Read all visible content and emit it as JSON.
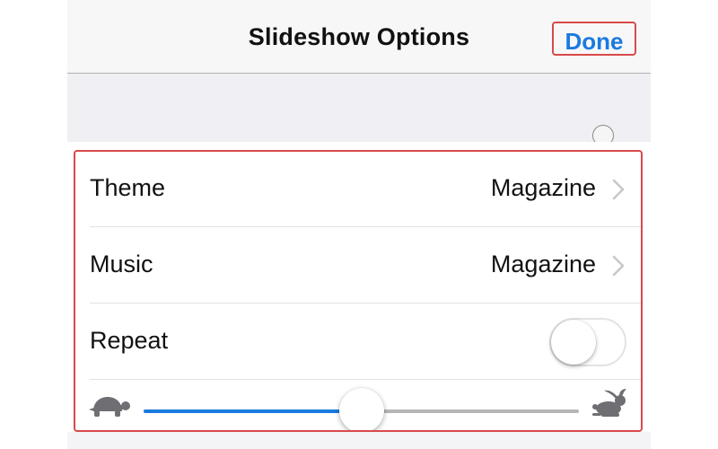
{
  "navigation": {
    "title": "Slideshow Options",
    "done_label": "Done"
  },
  "settings": {
    "theme": {
      "label": "Theme",
      "value": "Magazine"
    },
    "music": {
      "label": "Music",
      "value": "Magazine"
    },
    "repeat": {
      "label": "Repeat",
      "enabled": false
    }
  },
  "speed_slider": {
    "value": 0.5,
    "min_icon": "turtle-icon",
    "max_icon": "rabbit-icon"
  },
  "colors": {
    "accent": "#1b7ae0",
    "highlight": "#d84a4a",
    "background": "#efeff4"
  }
}
